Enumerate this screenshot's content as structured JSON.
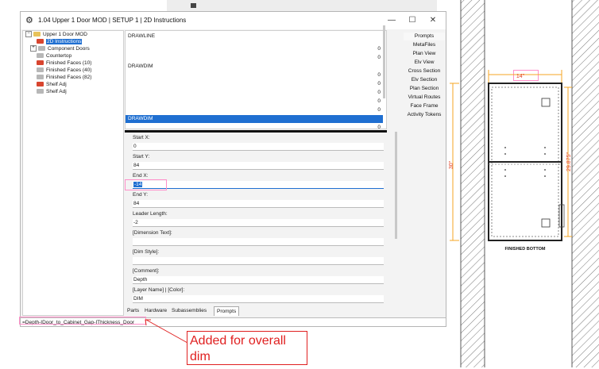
{
  "window": {
    "title": "1.04 Upper 1 Door MOD | SETUP 1 | 2D Instructions",
    "minimize": "—",
    "maximize": "☐",
    "close": "✕"
  },
  "tree": {
    "root": "Upper 1 Door MOD",
    "items": [
      {
        "label": "2D Instructions",
        "icon": "red-page-icon",
        "selected": true
      },
      {
        "label": "Component Doors",
        "icon": "folder-icon",
        "expandable": true
      },
      {
        "label": "Countertop",
        "icon": "page-icon"
      },
      {
        "label": "Finished Faces (10)",
        "icon": "red-page-icon"
      },
      {
        "label": "Finished Faces (40)",
        "icon": "page-icon"
      },
      {
        "label": "Finished Faces (82)",
        "icon": "page-icon"
      },
      {
        "label": "Shelf Adj",
        "icon": "red-page-icon"
      },
      {
        "label": "Shelf Adj",
        "icon": "page-icon"
      }
    ]
  },
  "list": {
    "rows": [
      {
        "key": "DRAWLINE",
        "value": ""
      },
      {
        "key": "",
        "value": "0"
      },
      {
        "key": "",
        "value": "0"
      },
      {
        "key": "DRAWDIM",
        "value": ""
      },
      {
        "key": "",
        "value": "0"
      },
      {
        "key": "",
        "value": "0"
      },
      {
        "key": "",
        "value": "0"
      },
      {
        "key": "",
        "value": "0"
      },
      {
        "key": "",
        "value": "0"
      },
      {
        "key": "DRAWDIM",
        "value": "",
        "selected": true
      },
      {
        "key": "",
        "value": "0"
      }
    ]
  },
  "props": {
    "fields": [
      {
        "label": "Start X:",
        "value": "0"
      },
      {
        "label": "Start Y:",
        "value": "84"
      },
      {
        "label": "End X:",
        "value": "-14",
        "active": true
      },
      {
        "label": "End Y:",
        "value": "84"
      },
      {
        "label": "Leader Length:",
        "value": "-2"
      },
      {
        "label": "[Dimension Text]:",
        "value": ""
      },
      {
        "label": "[Dim Style]:",
        "value": ""
      },
      {
        "label": "[Comment]:",
        "value": "Depth"
      },
      {
        "label": "[Layer Name] | [Color]:",
        "value": "DIM"
      }
    ]
  },
  "tabs": [
    "Parts",
    "Hardware",
    "Subassemblies",
    "Prompts"
  ],
  "active_tab": "Prompts",
  "side_buttons": [
    "Prompts",
    "MetaFiles",
    "Plan View",
    "Elv View",
    "Cross Section",
    "Elv Section",
    "Plan Section",
    "Virtual Routes",
    "Face Frame",
    "Activity Tokens"
  ],
  "formula": "=Depth-IDoor_to_Cabinet_Gap-IThickness_Door",
  "annotation": {
    "text": "Added for overall dim"
  },
  "drawing": {
    "dim_width": "14\"",
    "dim_height_left": "30\"",
    "dim_height_right": "29.875\"",
    "caption": "FINISHED BOTTOM"
  },
  "colors": {
    "accent_selection": "#1f6fd1",
    "dimension_orange": "#f5a623",
    "dimension_red": "#e03a1e",
    "highlight_pink": "#ff8fc9",
    "note_red": "#e02020"
  }
}
